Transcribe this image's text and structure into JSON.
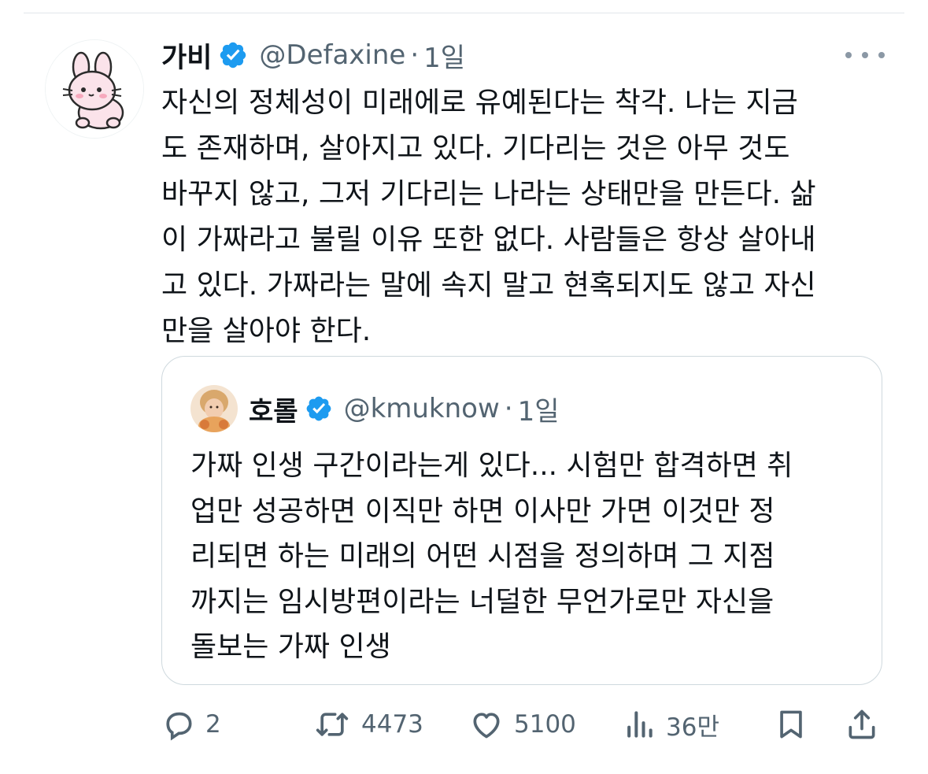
{
  "tweet": {
    "display_name": "가비",
    "handle": "@Defaxine",
    "separator": "·",
    "time": "1일",
    "text": "자신의 정체성이 미래에로 유예된다는 착각. 나는 지금\n도 존재하며, 살아지고 있다. 기다리는 것은 아무 것도\n바꾸지 않고, 그저 기다리는 나라는 상태만을 만든다. 삶\n이 가짜라고 불릴 이유 또한 없다. 사람들은 항상 살아내\n고 있다. 가짜라는 말에 속지 말고 현혹되지도 않고 자신\n만을 살아야 한다."
  },
  "quote": {
    "display_name": "호롤",
    "handle": "@kmuknow",
    "separator": "·",
    "time": "1일",
    "text": "가짜 인생 구간이라는게 있다... 시험만 합격하면 취\n업만 성공하면 이직만 하면 이사만 가면 이것만 정\n리되면 하는 미래의 어떤 시점을 정의하며 그 지점\n까지는 임시방편이라는 너덜한 무언가로만 자신을\n돌보는 가짜 인생"
  },
  "actions": {
    "replies": "2",
    "retweets": "4473",
    "likes": "5100",
    "views": "36만"
  },
  "icons": {
    "verified": "verified-badge-icon",
    "more": "more-dots-icon",
    "reply": "reply-bubble-icon",
    "retweet": "retweet-icon",
    "like": "heart-icon",
    "views": "views-chart-icon",
    "bookmark": "bookmark-icon",
    "share": "share-icon"
  },
  "colors": {
    "text": "#0f1419",
    "secondary": "#536471",
    "verified": "#1d9bf0",
    "border": "#cfd9de"
  }
}
